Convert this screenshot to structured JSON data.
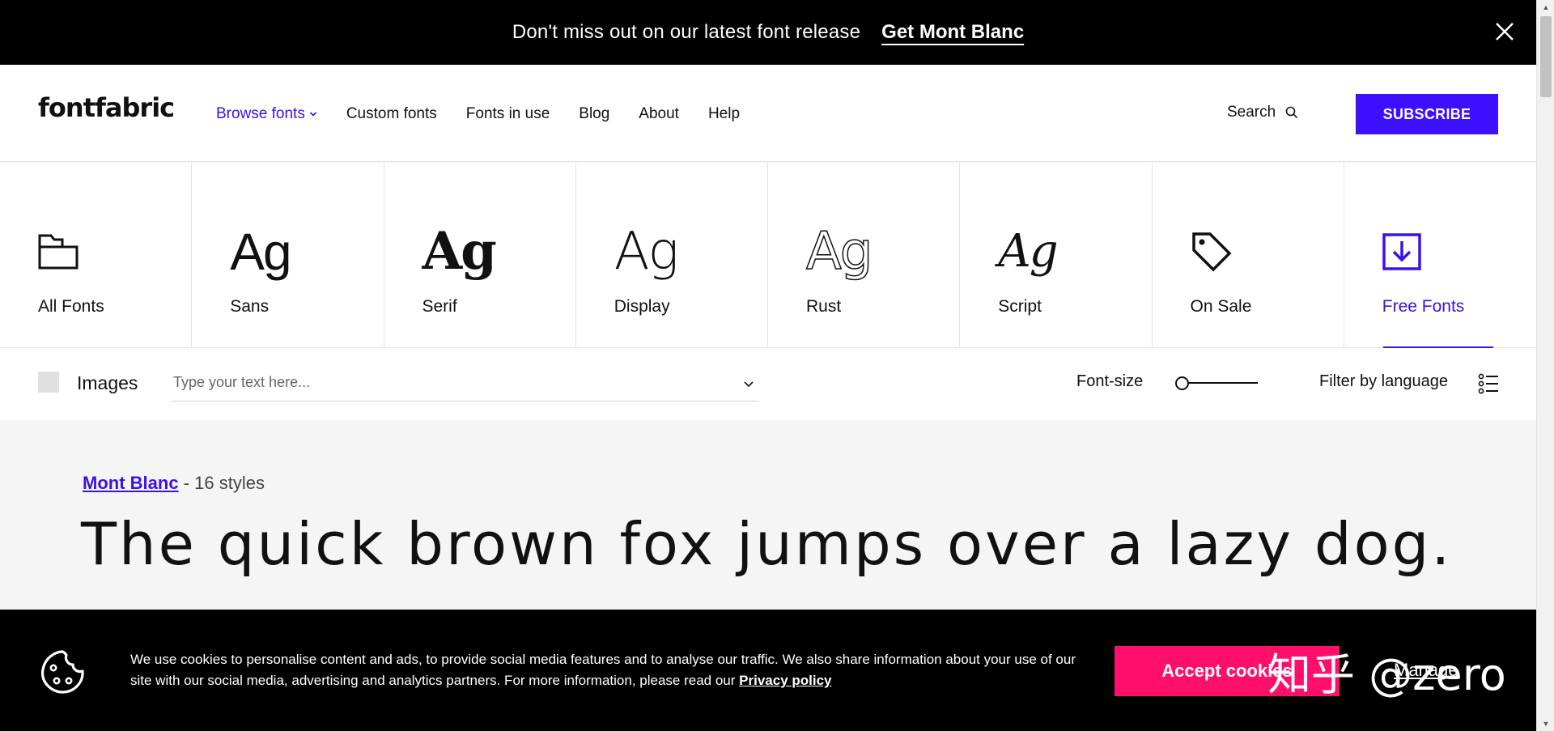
{
  "promo": {
    "text": "Don't miss out on our latest font release",
    "link": "Get Mont Blanc"
  },
  "header": {
    "logo": "fontfabric",
    "nav": [
      {
        "label": "Browse fonts"
      },
      {
        "label": "Custom fonts"
      },
      {
        "label": "Fonts in use"
      },
      {
        "label": "Blog"
      },
      {
        "label": "About"
      },
      {
        "label": "Help"
      }
    ],
    "search_label": "Search",
    "subscribe_label": "SUBSCRIBE",
    "accent_color": "#3d10ff"
  },
  "categories": [
    {
      "label": "All Fonts",
      "glyph": "",
      "icon": "folder-icon"
    },
    {
      "label": "Sans",
      "glyph": "Ag"
    },
    {
      "label": "Serif",
      "glyph": "Ag"
    },
    {
      "label": "Display",
      "glyph": "Ag"
    },
    {
      "label": "Rust",
      "glyph": "Ag"
    },
    {
      "label": "Script",
      "glyph": "Ag"
    },
    {
      "label": "On Sale",
      "glyph": "",
      "icon": "tag-icon"
    },
    {
      "label": "Free Fonts",
      "glyph": "",
      "icon": "download-icon",
      "selected": true
    }
  ],
  "filters": {
    "images_label": "Images",
    "text_placeholder": "Type your text here...",
    "font_size_label": "Font-size",
    "font_size_level": 0,
    "language_label": "Filter by language"
  },
  "font_card": {
    "font_name": "Mont Blanc",
    "styles": "- 16 styles",
    "sample": "The quick brown fox jumps over a lazy dog."
  },
  "cookie": {
    "text": "We use cookies to personalise content and ads, to provide social media features and to analyse our traffic. We also share information about your use of our site with our social media, advertising and analytics partners. For more information, please read our",
    "privacy_link": "Privacy policy",
    "accept_label": "Accept cookies",
    "manage_label": "Manage",
    "accept_color": "#ff0f6a"
  },
  "watermark": "知乎 @zero"
}
